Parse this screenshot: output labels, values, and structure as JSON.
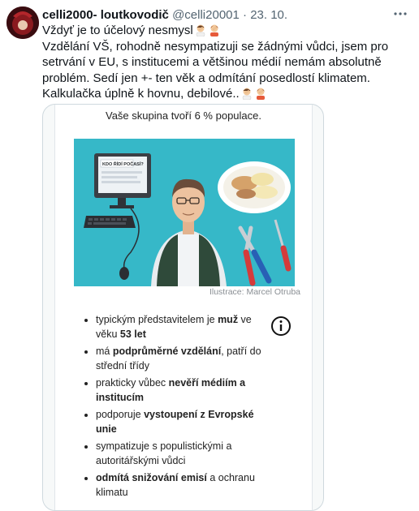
{
  "tweet": {
    "author_name": "celli2000- loutkovodič",
    "handle": "@celli20001",
    "separator": "·",
    "date": "23. 10.",
    "lines": [
      "Vždyť je to účelový nesmysl",
      "Vzdělání VŠ, rohodně nesympatizuji se žádnými vůdci, jsem pro setrvání v EU, s institucemi a většinou médií nemám absolutně problém. Sedí jen +- ten věk a odmítání posedlostí klimatem.",
      "Kalkulačka úplně k hovnu, debilové.."
    ]
  },
  "card": {
    "heading": "Vaše skupina tvoří 6 % populace.",
    "sign_text": "KDO ŘÍDÍ POČASÍ?",
    "credit": "Ilustrace: Marcel Otruba",
    "bullets": [
      [
        {
          "t": "typickým představitelem je "
        },
        {
          "t": "muž",
          "b": true
        },
        {
          "t": " ve věku "
        },
        {
          "t": "53 let",
          "b": true
        }
      ],
      [
        {
          "t": "má "
        },
        {
          "t": "podprůměrné vzdělání",
          "b": true
        },
        {
          "t": ", patří do střední třídy"
        }
      ],
      [
        {
          "t": "prakticky vůbec "
        },
        {
          "t": "nevěří médiím a institucím",
          "b": true
        }
      ],
      [
        {
          "t": "podporuje "
        },
        {
          "t": "vystoupení z Evropské unie",
          "b": true
        }
      ],
      [
        {
          "t": "sympatizuje s populistickými a autoritářskými vůdci"
        }
      ],
      [
        {
          "t": "odmítá snižování emisí",
          "b": true
        },
        {
          "t": " a ochranu klimatu"
        }
      ]
    ]
  },
  "icons": {
    "more": "more-dots-icon",
    "info": "info-circle-icon",
    "emoji": "person-facepalming-emoji"
  },
  "colors": {
    "illustration_bg": "#36b8c8",
    "secondary_text": "#536471",
    "border": "#cfd9de"
  }
}
